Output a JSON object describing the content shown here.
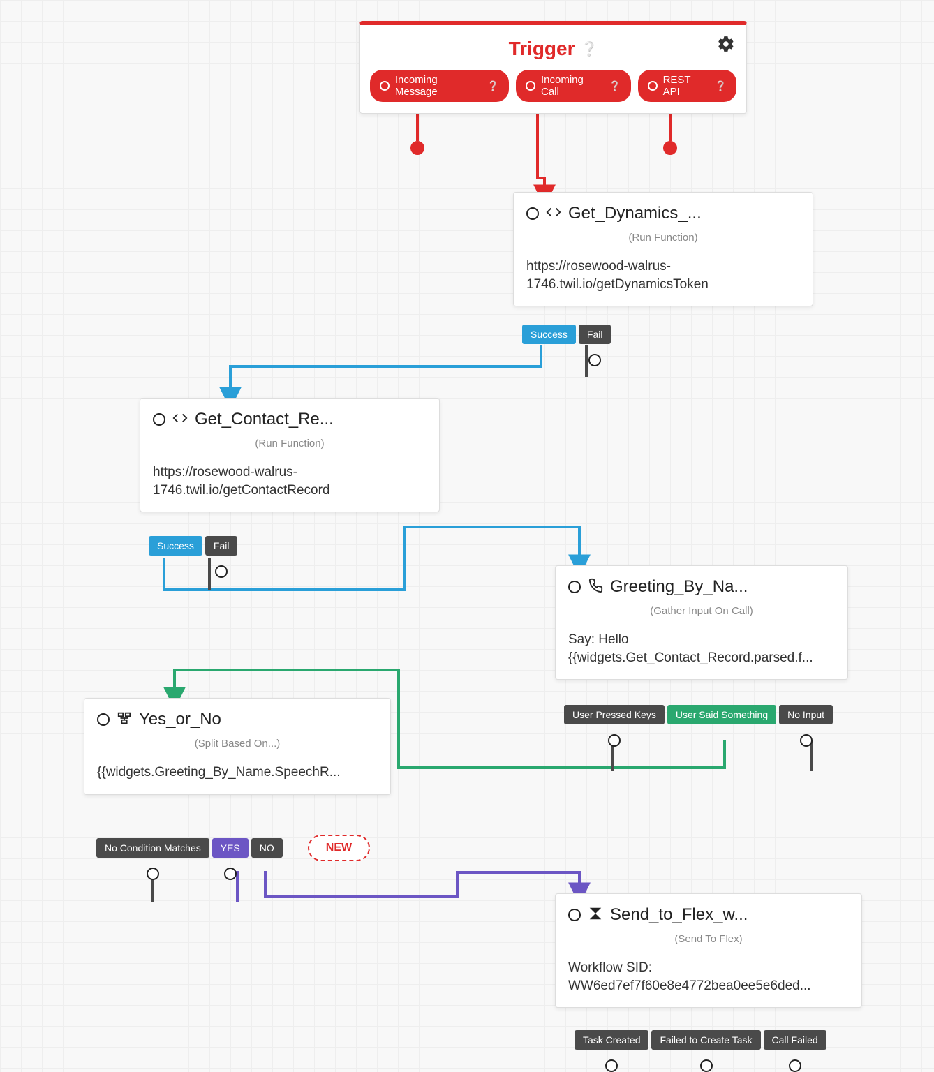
{
  "trigger": {
    "title": "Trigger",
    "pills": {
      "incoming_message": "Incoming Message",
      "incoming_call": "Incoming Call",
      "rest_api": "REST API"
    }
  },
  "get_dynamics": {
    "title": "Get_Dynamics_...",
    "subtitle": "(Run Function)",
    "body": "https://rosewood-walrus-1746.twil.io/getDynamicsToken",
    "outcomes": {
      "success": "Success",
      "fail": "Fail"
    }
  },
  "get_contact": {
    "title": "Get_Contact_Re...",
    "subtitle": "(Run Function)",
    "body": "https://rosewood-walrus-1746.twil.io/getContactRecord",
    "outcomes": {
      "success": "Success",
      "fail": "Fail"
    }
  },
  "greeting": {
    "title": "Greeting_By_Na...",
    "subtitle": "(Gather Input On Call)",
    "body": "Say: Hello {{widgets.Get_Contact_Record.parsed.f...",
    "outcomes": {
      "pressed": "User Pressed Keys",
      "said": "User Said Something",
      "noinput": "No Input"
    }
  },
  "yes_or_no": {
    "title": "Yes_or_No",
    "subtitle": "(Split Based On...)",
    "body": "{{widgets.Greeting_By_Name.SpeechR...",
    "outcomes": {
      "nomatch": "No Condition Matches",
      "yes": "YES",
      "no": "NO",
      "new": "NEW"
    }
  },
  "send_flex": {
    "title": "Send_to_Flex_w...",
    "subtitle": "(Send To Flex)",
    "body": "Workflow SID: WW6ed7ef7f60e8e4772bea0ee5e6ded...",
    "outcomes": {
      "created": "Task Created",
      "failed": "Failed to Create Task",
      "callfailed": "Call Failed"
    }
  }
}
